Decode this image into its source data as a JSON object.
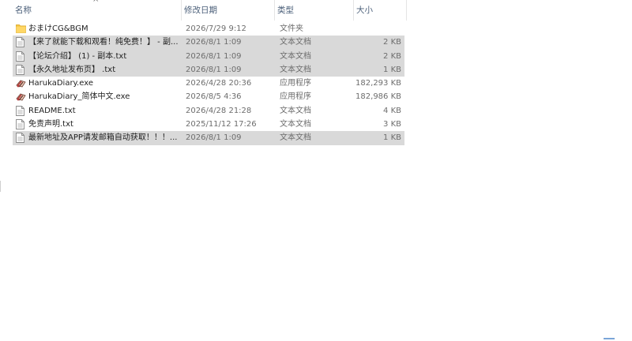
{
  "columns": {
    "name": "名称",
    "date": "修改日期",
    "type": "类型",
    "size": "大小"
  },
  "sort_indicator": "^",
  "files": [
    {
      "name": "おまけCG&BGM",
      "date": "2026/7/29 9:12",
      "type": "文件夹",
      "size": "",
      "icon": "folder-icon",
      "selected": false
    },
    {
      "name": "【来了就能下载和观看！纯免费！】 - 副...",
      "date": "2026/8/1 1:09",
      "type": "文本文档",
      "size": "2 KB",
      "icon": "text-file-icon",
      "selected": true
    },
    {
      "name": "【论坛介绍】 (1) - 副本.txt",
      "date": "2026/8/1 1:09",
      "type": "文本文档",
      "size": "2 KB",
      "icon": "text-file-icon",
      "selected": true
    },
    {
      "name": "【永久地址发布页】 .txt",
      "date": "2026/8/1 1:09",
      "type": "文本文档",
      "size": "1 KB",
      "icon": "text-file-icon",
      "selected": true
    },
    {
      "name": "HarukaDiary.exe",
      "date": "2026/4/28 20:36",
      "type": "应用程序",
      "size": "182,293 KB",
      "icon": "app-icon",
      "selected": false
    },
    {
      "name": "HarukaDiary_简体中文.exe",
      "date": "2026/8/5 4:36",
      "type": "应用程序",
      "size": "182,986 KB",
      "icon": "app-icon",
      "selected": false
    },
    {
      "name": "README.txt",
      "date": "2026/4/28 21:28",
      "type": "文本文档",
      "size": "4 KB",
      "icon": "text-file-icon",
      "selected": false
    },
    {
      "name": "免责声明.txt",
      "date": "2025/11/12 17:26",
      "type": "文本文档",
      "size": "3 KB",
      "icon": "text-file-icon",
      "selected": false
    },
    {
      "name": "最新地址及APP请发邮箱自动获取！！！...",
      "date": "2026/8/1 1:09",
      "type": "文本文档",
      "size": "1 KB",
      "icon": "text-file-icon",
      "selected": true
    }
  ],
  "colors": {
    "selection": "#d9d9d9",
    "header_text": "#4c607a",
    "folder": "#f5c542",
    "app_accent": "#b43c3c"
  }
}
